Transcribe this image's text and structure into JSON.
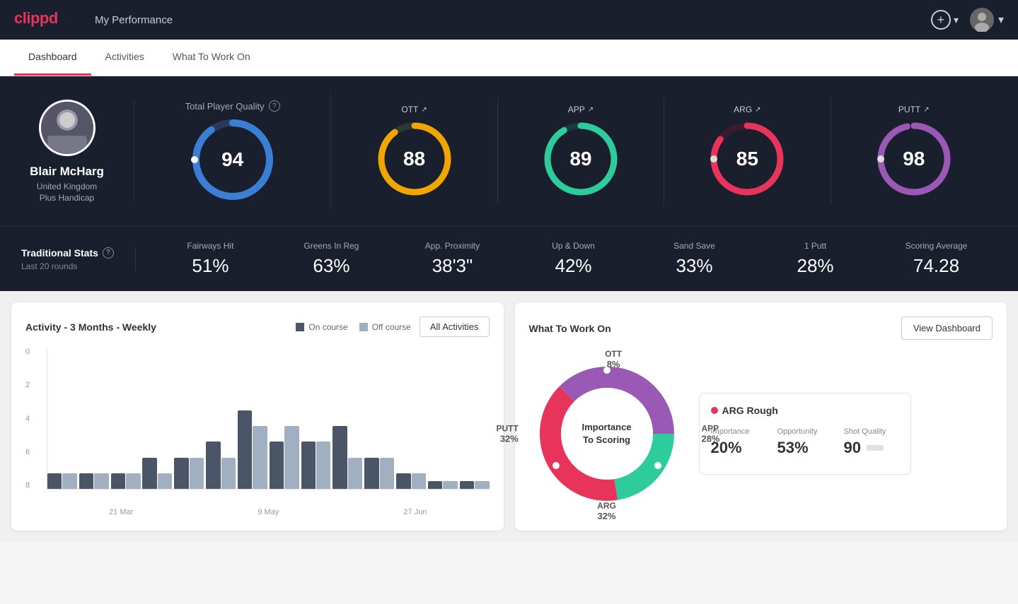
{
  "header": {
    "logo": "clippd",
    "title": "My Performance",
    "add_label": "+",
    "user_chevron": "▾"
  },
  "nav": {
    "tabs": [
      "Dashboard",
      "Activities",
      "What To Work On"
    ],
    "active": "Dashboard"
  },
  "hero": {
    "player_name": "Blair McHarg",
    "player_country": "United Kingdom",
    "player_hcp": "Plus Handicap",
    "tpq_label": "Total Player Quality",
    "tpq_value": 94,
    "scores": [
      {
        "label": "OTT",
        "value": 88,
        "color": "#f0a500"
      },
      {
        "label": "APP",
        "value": 89,
        "color": "#2ecc9a"
      },
      {
        "label": "ARG",
        "value": 85,
        "color": "#e8335a"
      },
      {
        "label": "PUTT",
        "value": 98,
        "color": "#9b59b6"
      }
    ]
  },
  "traditional_stats": {
    "title": "Traditional Stats",
    "subtitle": "Last 20 rounds",
    "stats": [
      {
        "label": "Fairways Hit",
        "value": "51%"
      },
      {
        "label": "Greens In Reg",
        "value": "63%"
      },
      {
        "label": "App. Proximity",
        "value": "38'3\""
      },
      {
        "label": "Up & Down",
        "value": "42%"
      },
      {
        "label": "Sand Save",
        "value": "33%"
      },
      {
        "label": "1 Putt",
        "value": "28%"
      },
      {
        "label": "Scoring Average",
        "value": "74.28"
      }
    ]
  },
  "activity_chart": {
    "title": "Activity - 3 Months - Weekly",
    "legend": [
      {
        "label": "On course",
        "color": "#4a5568"
      },
      {
        "label": "Off course",
        "color": "#a0b0c0"
      }
    ],
    "all_activities_btn": "All Activities",
    "y_labels": [
      "0",
      "2",
      "4",
      "6",
      "8"
    ],
    "x_labels": [
      "21 Mar",
      "9 May",
      "27 Jun"
    ],
    "bars": [
      {
        "on": 1,
        "off": 1
      },
      {
        "on": 1,
        "off": 1
      },
      {
        "on": 1,
        "off": 1
      },
      {
        "on": 2,
        "off": 1
      },
      {
        "on": 2,
        "off": 2
      },
      {
        "on": 3,
        "off": 2
      },
      {
        "on": 5,
        "off": 4
      },
      {
        "on": 3,
        "off": 4
      },
      {
        "on": 3,
        "off": 3
      },
      {
        "on": 4,
        "off": 2
      },
      {
        "on": 2,
        "off": 2
      },
      {
        "on": 1,
        "off": 1
      },
      {
        "on": 0.5,
        "off": 0.5
      },
      {
        "on": 0.5,
        "off": 0.5
      }
    ]
  },
  "wtwo": {
    "title": "What To Work On",
    "view_btn": "View Dashboard",
    "donut": {
      "center_line1": "Importance",
      "center_line2": "To Scoring",
      "segments": [
        {
          "label": "OTT",
          "pct": "8%",
          "color": "#f0a500"
        },
        {
          "label": "APP",
          "pct": "28%",
          "color": "#2ecc9a"
        },
        {
          "label": "ARG",
          "pct": "32%",
          "color": "#e8335a"
        },
        {
          "label": "PUTT",
          "pct": "32%",
          "color": "#9b59b6"
        }
      ]
    },
    "info_card": {
      "title": "ARG Rough",
      "dot_color": "#e8335a",
      "metrics": [
        {
          "label": "Importance",
          "value": "20%"
        },
        {
          "label": "Opportunity",
          "value": "53%"
        },
        {
          "label": "Shot Quality",
          "value": "90"
        }
      ]
    }
  }
}
